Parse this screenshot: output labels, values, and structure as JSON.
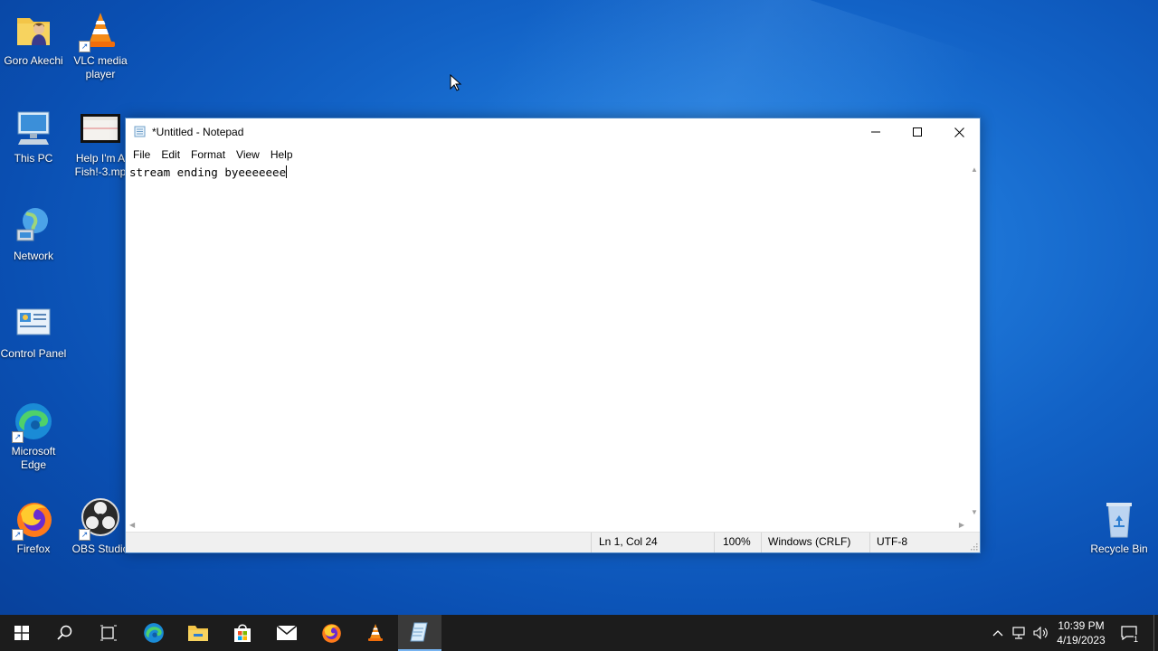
{
  "desktop": {
    "icons": [
      {
        "label": "Goro Akechi"
      },
      {
        "label": "VLC media player"
      },
      {
        "label": "This PC"
      },
      {
        "label": "Help I'm A Fish!-3.mp"
      },
      {
        "label": "Network"
      },
      {
        "label": "Control Panel"
      },
      {
        "label": "Microsoft Edge"
      },
      {
        "label": "Firefox"
      },
      {
        "label": "OBS Studio"
      },
      {
        "label": "Recycle Bin"
      }
    ]
  },
  "notepad": {
    "title": "*Untitled - Notepad",
    "menu": [
      "File",
      "Edit",
      "Format",
      "View",
      "Help"
    ],
    "content": "stream ending byeeeeeee",
    "status": {
      "position": "Ln 1, Col 24",
      "zoom": "100%",
      "line_ending": "Windows (CRLF)",
      "encoding": "UTF-8"
    }
  },
  "taskbar": {
    "apps": [
      "start",
      "search",
      "task-view",
      "edge",
      "file-explorer",
      "store",
      "mail",
      "firefox",
      "vlc",
      "notepad"
    ],
    "active_app": "notepad",
    "clock": {
      "time": "10:39 PM",
      "date": "4/19/2023"
    },
    "notification_count": "1"
  },
  "colors": {
    "desktop_blue": "#1262c6",
    "taskbar": "#1c1c1c",
    "active_indicator": "#77b3f0"
  }
}
